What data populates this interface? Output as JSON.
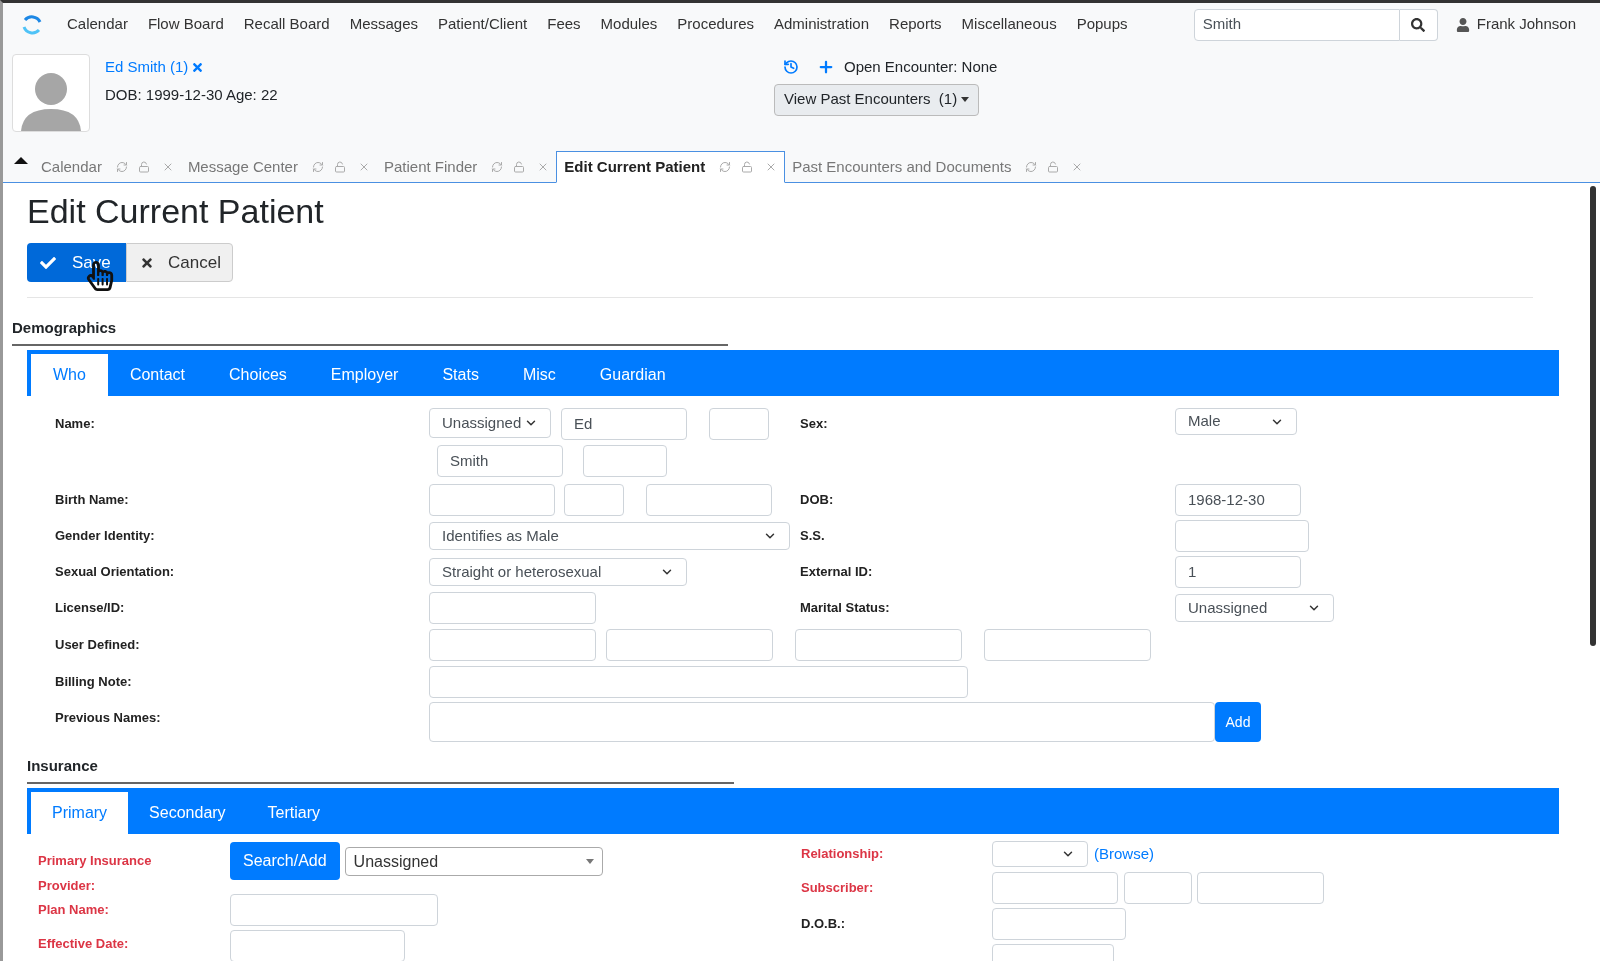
{
  "nav": {
    "items": [
      "Calendar",
      "Flow Board",
      "Recall Board",
      "Messages",
      "Patient/Client",
      "Fees",
      "Modules",
      "Procedures",
      "Administration",
      "Reports",
      "Miscellaneous",
      "Popups"
    ],
    "search": {
      "value": "Smith"
    },
    "user": "Frank Johnson"
  },
  "patient": {
    "name": "Ed Smith (1)",
    "dob_age": "DOB: 1999-12-30 Age: 22",
    "encounter": "Open Encounter: None",
    "past_button": "View Past Encounters  (1)"
  },
  "tabs": [
    {
      "label": "Calendar",
      "selected": false
    },
    {
      "label": "Message Center",
      "selected": false
    },
    {
      "label": "Patient Finder",
      "selected": false
    },
    {
      "label": "Edit Current Patient",
      "selected": true
    },
    {
      "label": "Past Encounters and Documents",
      "selected": false
    }
  ],
  "page": {
    "title": "Edit Current Patient",
    "save": "Save",
    "cancel": "Cancel"
  },
  "demographics": {
    "heading": "Demographics",
    "tabs": [
      {
        "label": "Who",
        "selected": true
      },
      {
        "label": "Contact",
        "selected": false
      },
      {
        "label": "Choices",
        "selected": false
      },
      {
        "label": "Employer",
        "selected": false
      },
      {
        "label": "Stats",
        "selected": false
      },
      {
        "label": "Misc",
        "selected": false
      },
      {
        "label": "Guardian",
        "selected": false
      }
    ],
    "name": {
      "label": "Name:",
      "title": "Unassigned",
      "first": "Ed",
      "last": "Smith"
    },
    "sex": {
      "label": "Sex:",
      "value": "Male"
    },
    "birth_name": {
      "label": "Birth Name:"
    },
    "dob": {
      "label": "DOB:",
      "value": "1968-12-30"
    },
    "gender_identity": {
      "label": "Gender Identity:",
      "value": "Identifies as Male"
    },
    "ss": {
      "label": "S.S."
    },
    "sexual_orientation": {
      "label": "Sexual Orientation:",
      "value": "Straight or heterosexual"
    },
    "external_id": {
      "label": "External ID:",
      "value": "1"
    },
    "license": {
      "label": "License/ID:"
    },
    "marital_status": {
      "label": "Marital Status:",
      "value": "Unassigned"
    },
    "user_defined": {
      "label": "User Defined:"
    },
    "billing_note": {
      "label": "Billing Note:"
    },
    "previous_names": {
      "label": "Previous Names:",
      "button": "Add"
    }
  },
  "insurance": {
    "heading": "Insurance",
    "tabs": [
      {
        "label": "Primary",
        "selected": true
      },
      {
        "label": "Secondary",
        "selected": false
      },
      {
        "label": "Tertiary",
        "selected": false
      }
    ],
    "provider": {
      "label": "Primary Insurance Provider:",
      "button": "Search/Add",
      "value": "Unassigned"
    },
    "plan_name": {
      "label": "Plan Name:"
    },
    "effective_date": {
      "label": "Effective Date:"
    },
    "relationship": {
      "label": "Relationship:",
      "link": "(Browse)"
    },
    "subscriber": {
      "label": "Subscriber:"
    },
    "dob": {
      "label": "D.O.B.:"
    }
  }
}
